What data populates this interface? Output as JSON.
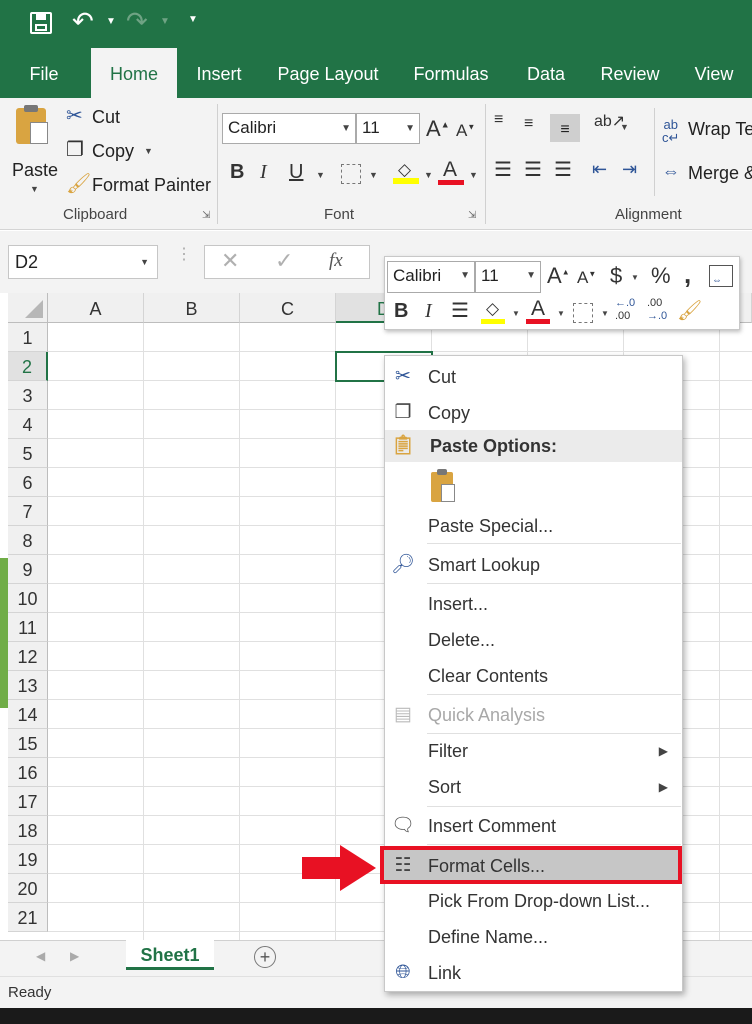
{
  "quick_access": {
    "save_icon": "save-icon",
    "undo_icon": "undo-icon",
    "redo_icon": "redo-icon",
    "customize_icon": "customize-icon"
  },
  "tabs": [
    "File",
    "Home",
    "Insert",
    "Page Layout",
    "Formulas",
    "Data",
    "Review",
    "View"
  ],
  "active_tab": "Home",
  "ribbon": {
    "clipboard": {
      "paste": "Paste",
      "cut": "Cut",
      "copy": "Copy",
      "format_painter": "Format Painter",
      "label": "Clipboard"
    },
    "font": {
      "font_name": "Calibri",
      "font_size": "11",
      "label": "Font",
      "bold": "B",
      "italic": "I",
      "underline": "U",
      "grow": "A",
      "shrink": "A",
      "font_color_letter": "A"
    },
    "alignment": {
      "wrap_text": "Wrap Te",
      "merge": "Merge &",
      "label": "Alignment"
    }
  },
  "formula_bar": {
    "name_box": "D2",
    "fx": "fx",
    "value": ""
  },
  "columns": [
    "A",
    "B",
    "C",
    "D"
  ],
  "rows": [
    "1",
    "2",
    "3",
    "4",
    "5",
    "6",
    "7",
    "8",
    "9",
    "10",
    "11",
    "12",
    "13",
    "14",
    "15",
    "16",
    "17",
    "18",
    "19",
    "20",
    "21"
  ],
  "mini_toolbar": {
    "font_name": "Calibri",
    "font_size": "11",
    "currency": "$",
    "percent": "%",
    "comma": ",",
    "bold": "B",
    "italic": "I",
    "font_color_letter": "A",
    "inc_decimal_top": "←.0",
    "inc_decimal_bottom": ".00",
    "dec_decimal_top": ".00",
    "dec_decimal_bottom": "→.0"
  },
  "context_menu": {
    "cut": "Cut",
    "copy": "Copy",
    "paste_options": "Paste Options:",
    "paste_special": "Paste Special...",
    "smart_lookup": "Smart Lookup",
    "insert": "Insert...",
    "delete": "Delete...",
    "clear_contents": "Clear Contents",
    "quick_analysis": "Quick Analysis",
    "filter": "Filter",
    "sort": "Sort",
    "insert_comment": "Insert Comment",
    "format_cells": "Format Cells...",
    "pick_from_list": "Pick From Drop-down List...",
    "define_name": "Define Name...",
    "link": "Link"
  },
  "sheet_tabs": [
    "Sheet1"
  ],
  "status": "Ready",
  "colors": {
    "excel_green": "#217346",
    "highlight_red": "#e81123",
    "menu_hover": "#c6c6c6"
  }
}
